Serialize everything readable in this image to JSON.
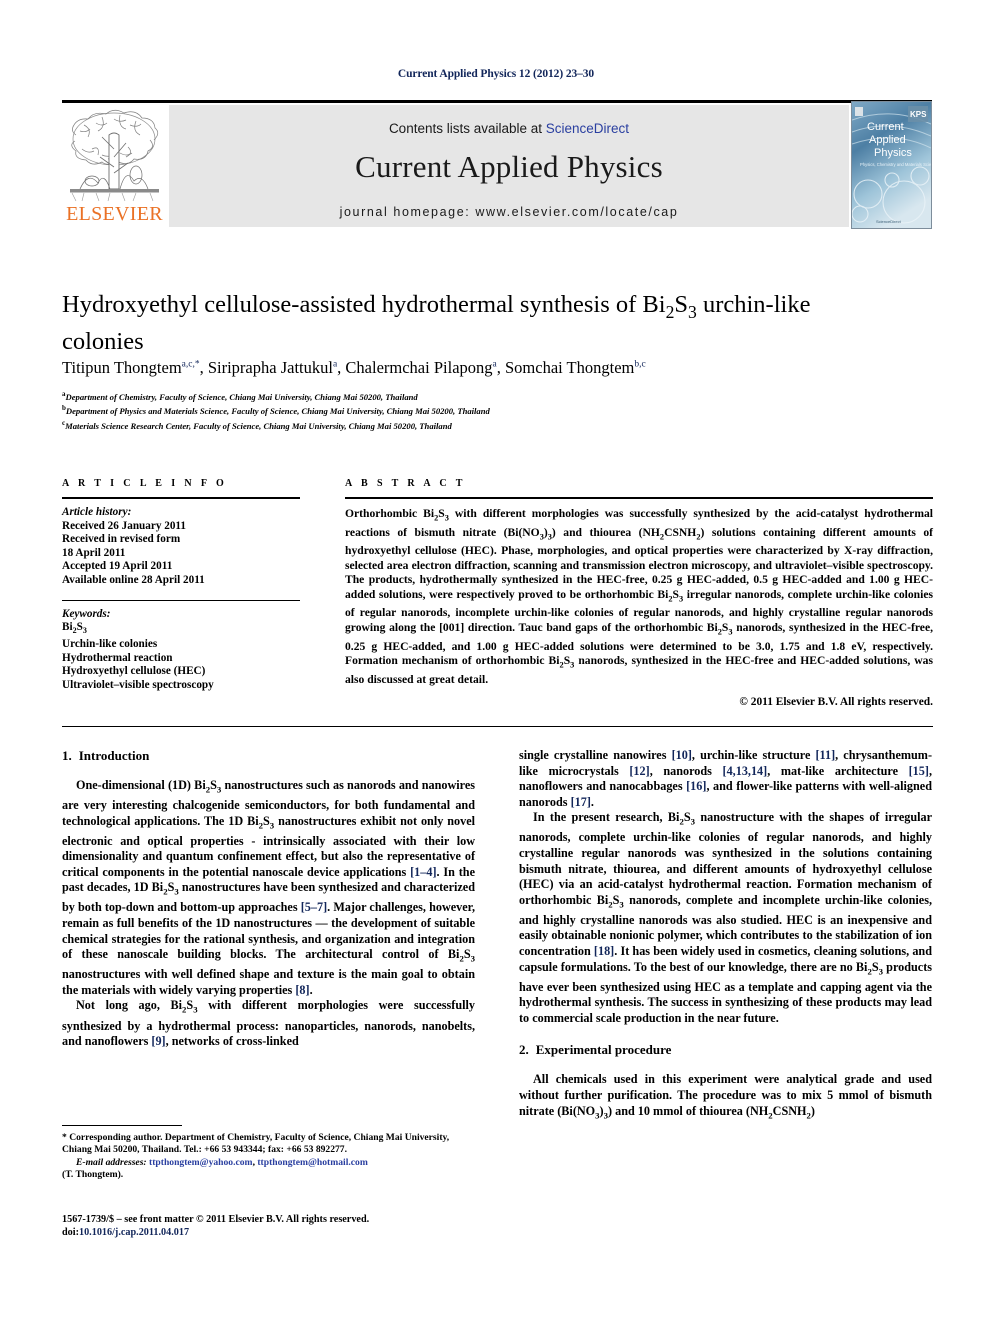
{
  "running_head": "Current Applied Physics 12 (2012) 23–30",
  "masthead": {
    "contents_prefix": "Contents lists available at ",
    "sciencedirect": "ScienceDirect",
    "journal_title": "Current Applied Physics",
    "journal_homepage": "journal homepage: www.elsevier.com/locate/cap",
    "publisher_wordmark": "ELSEVIER",
    "publisher_logo_icon": "elsevier-tree-icon",
    "cover_title_line1": "Current",
    "cover_title_line2": "Applied",
    "cover_title_line3": "Physics",
    "cover_subtitle": "Physics, Chemistry and Materials Science",
    "cover_badge": "KPS"
  },
  "article": {
    "title_part1": "Hydroxyethyl cellulose-assisted hydrothermal synthesis of Bi",
    "title_sub1": "2",
    "title_mid": "S",
    "title_sub2": "3",
    "title_part2": " urchin-like colonies",
    "authors_plain": "Titipun Thongtem a,c,*, Siriprapha Jattukul a, Chalermchai Pilapong a, Somchai Thongtem b,c",
    "authors": [
      {
        "name": "Titipun Thongtem",
        "marks": "a,c,",
        "star": "*"
      },
      {
        "name": "Siriprapha Jattukul",
        "marks": "a",
        "star": ""
      },
      {
        "name": "Chalermchai Pilapong",
        "marks": "a",
        "star": ""
      },
      {
        "name": "Somchai Thongtem",
        "marks": "b,c",
        "star": ""
      }
    ],
    "affiliations": [
      {
        "mark": "a",
        "text": "Department of Chemistry, Faculty of Science, Chiang Mai University, Chiang Mai 50200, Thailand"
      },
      {
        "mark": "b",
        "text": "Department of Physics and Materials Science, Faculty of Science, Chiang Mai University, Chiang Mai 50200, Thailand"
      },
      {
        "mark": "c",
        "text": "Materials Science Research Center, Faculty of Science, Chiang Mai University, Chiang Mai 50200, Thailand"
      }
    ]
  },
  "article_info": {
    "heading": "A R T I C L E   I N F O",
    "history_label": "Article history:",
    "history": [
      "Received 26 January 2011",
      "Received in revised form",
      "18 April 2011",
      "Accepted 19 April 2011",
      "Available online 28 April 2011"
    ],
    "keywords_label": "Keywords:",
    "keywords": [
      "Bi2S3",
      "Urchin-like colonies",
      "Hydrothermal reaction",
      "Hydroxyethyl cellulose (HEC)",
      "Ultraviolet–visible spectroscopy"
    ]
  },
  "abstract": {
    "heading": "A B S T R A C T",
    "text": "Orthorhombic Bi2S3 with different morphologies was successfully synthesized by the acid-catalyst hydrothermal reactions of bismuth nitrate (Bi(NO3)3) and thiourea (NH2CSNH2) solutions containing different amounts of hydroxyethyl cellulose (HEC). Phase, morphologies, and optical properties were characterized by X-ray diffraction, selected area electron diffraction, scanning and transmission electron microscopy, and ultraviolet–visible spectroscopy. The products, hydrothermally synthesized in the HEC-free, 0.25 g HEC-added, 0.5 g HEC-added and 1.00 g HEC-added solutions, were respectively proved to be orthorhombic Bi2S3 irregular nanorods, complete urchin-like colonies of regular nanorods, incomplete urchin-like colonies of regular nanorods, and highly crystalline regular nanorods growing along the [001] direction. Tauc band gaps of the orthorhombic Bi2S3 nanorods, synthesized in the HEC-free, 0.25 g HEC-added, and 1.00 g HEC-added solutions were determined to be 3.0, 1.75 and 1.8 eV, respectively. Formation mechanism of orthorhombic Bi2S3 nanorods, synthesized in the HEC-free and HEC-added solutions, was also discussed at great detail.",
    "copyright": "© 2011 Elsevier B.V. All rights reserved."
  },
  "sections": {
    "intro": {
      "number": "1.",
      "title": "Introduction",
      "para1": "One-dimensional (1D) Bi2S3 nanostructures such as nanorods and nanowires are very interesting chalcogenide semiconductors, for both fundamental and technological applications. The 1D Bi2S3 nanostructures exhibit not only novel electronic and optical properties - intrinsically associated with their low dimensionality and quantum confinement effect, but also the representative of critical components in the potential nanoscale device applications [1–4]. In the past decades, 1D Bi2S3 nanostructures have been synthesized and characterized by both top-down and bottom-up approaches [5–7]. Major challenges, however, remain as full benefits of the 1D nanostructures — the development of suitable chemical strategies for the rational synthesis, and organization and integration of these nanoscale building blocks. The architectural control of Bi2S3 nanostructures with well defined shape and texture is the main goal to obtain the materials with widely varying properties [8].",
      "para2": "Not long ago, Bi2S3 with different morphologies were successfully synthesized by a hydrothermal process: nanoparticles, nanorods, nanobelts, and nanoflowers [9], networks of cross-linked single crystalline nanowires [10], urchin-like structure [11], chrysanthemum-like microcrystals [12], nanorods [4,13,14], mat-like architecture [15], nanoflowers and nanocabbages [16], and flower-like patterns with well-aligned nanorods [17].",
      "para3": "In the present research, Bi2S3 nanostructure with the shapes of irregular nanorods, complete urchin-like colonies of regular nanorods, and highly crystalline regular nanorods was synthesized in the solutions containing bismuth nitrate, thiourea, and different amounts of hydroxyethyl cellulose (HEC) via an acid-catalyst hydrothermal reaction. Formation mechanism of orthorhombic Bi2S3 nanorods, complete and incomplete urchin-like colonies, and highly crystalline nanorods was also studied. HEC is an inexpensive and easily obtainable nonionic polymer, which contributes to the stabilization of ion concentration [18]. It has been widely used in cosmetics, cleaning solutions, and capsule formulations. To the best of our knowledge, there are no Bi2S3 products have ever been synthesized using HEC as a template and capping agent via the hydrothermal synthesis. The success in synthesizing of these products may lead to commercial scale production in the near future."
    },
    "experimental": {
      "number": "2.",
      "title": "Experimental procedure",
      "para1": "All chemicals used in this experiment were analytical grade and used without further purification. The procedure was to mix 5 mmol of bismuth nitrate (Bi(NO3)3) and 10 mmol of thiourea (NH2CSNH2)"
    }
  },
  "footnotes": {
    "corresponding": "* Corresponding author. Department of Chemistry, Faculty of Science, Chiang Mai University, Chiang Mai 50200, Thailand. Tel.: +66 53 943344; fax: +66 53 892277.",
    "email_label": "E-mail addresses:",
    "email1": "ttpthongtem@yahoo.com",
    "email2": "ttpthongtem@hotmail.com",
    "email_person": "(T. Thongtem).",
    "issn_line": "1567-1739/$ – see front matter © 2011 Elsevier B.V. All rights reserved.",
    "doi_label": "doi:",
    "doi_value": "10.1016/j.cap.2011.04.017"
  },
  "colors": {
    "elsevier_orange": "#ea7125",
    "link_blue": "#2a3fa0",
    "ref_navy": "#12265a",
    "band_gray": "#e6e6e6"
  }
}
